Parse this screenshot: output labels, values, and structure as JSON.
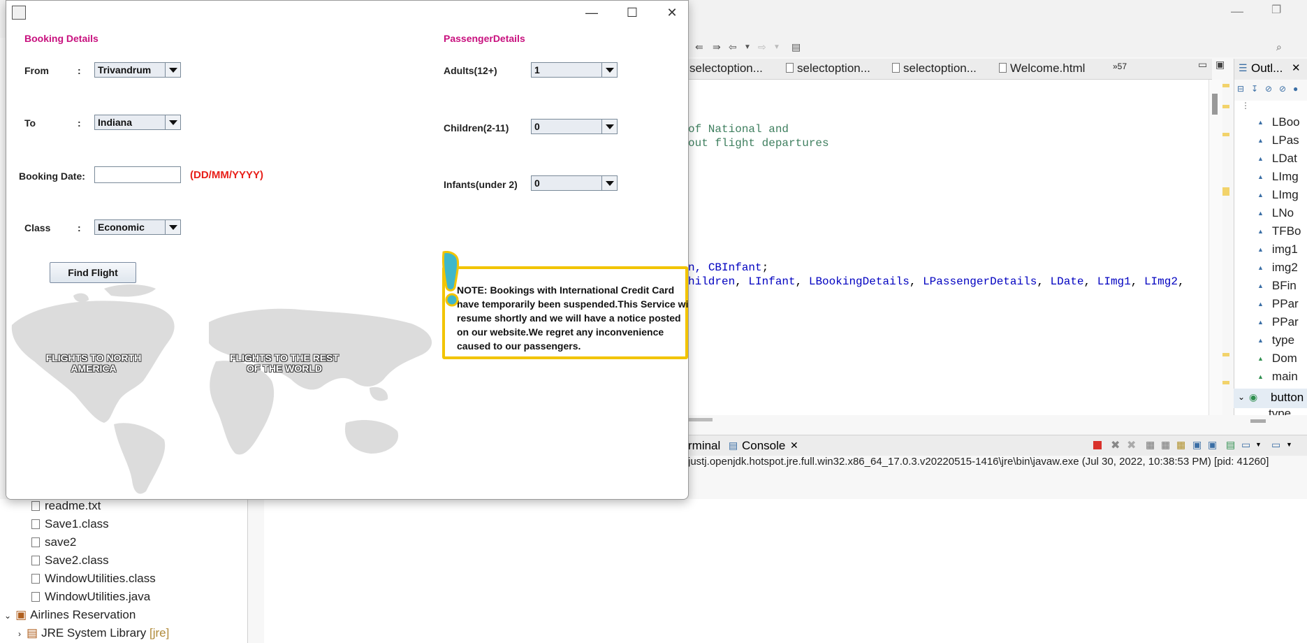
{
  "app": {
    "title": "",
    "window_controls": {
      "minimize": "—",
      "maximize": "☐",
      "close": "✕"
    },
    "booking_details_title": "Booking Details",
    "passenger_details_title": "PassengerDetails",
    "from": {
      "label": "From",
      "colon": ":",
      "value": "Trivandrum"
    },
    "to": {
      "label": "To",
      "colon": ":",
      "value": "Indiana"
    },
    "booking_date": {
      "label": "Booking Date:",
      "value": "",
      "format_hint": "(DD/MM/YYYY)"
    },
    "class": {
      "label": "Class",
      "colon": ":",
      "value": "Economic"
    },
    "find_flight_button": "Find Flight",
    "adults": {
      "label": "Adults(12+)",
      "value": "1"
    },
    "children": {
      "label": "Children(2-11)",
      "value": "0"
    },
    "infants": {
      "label": "Infants(under 2)",
      "value": "0"
    },
    "note": "NOTE: Bookings with International Credit Card have temporarily been suspended.This Service will resume shortly and we will have a notice posted on our website.We regret any inconvenience caused to our passengers.",
    "map_labels": {
      "north_america": "FLIGHTS TO NORTH AMERICA",
      "rest_of_world": "FLIGHTS TO THE REST OF THE WORLD"
    }
  },
  "ide": {
    "tabs": [
      "selectoption...",
      "selectoption...",
      "selectoption...",
      "Welcome.html",
      "»57"
    ],
    "code": {
      "line1": "of National and",
      "line2": "out flight departures",
      "line3_a": "n, ",
      "line3_b": "CBInfant",
      "line3_c": ";",
      "line4_a": "hildren",
      "line4_sep1": ", ",
      "line4_b": "LInfant",
      "line4_sep2": ", ",
      "line4_c": "LBookingDetails",
      "line4_sep3": ", ",
      "line4_d": "LPassengerDetails",
      "line4_sep4": ", ",
      "line4_e": "LDate",
      "line4_sep5": ", ",
      "line4_f": "LImg1",
      "line4_sep6": ", ",
      "line4_g": "LImg2",
      "line4_sep7": ","
    },
    "outline_title": "Outl...",
    "outline_items": [
      "LBoo",
      "LPas",
      "LDat",
      "LImg",
      "LImg",
      "LNo",
      "TFBo",
      "img1",
      "img2",
      "BFin",
      "PPar",
      "PPar",
      "type",
      "Dom",
      "main"
    ],
    "outline_node": "button",
    "outline_last": "type",
    "console_tabs": {
      "terminal": "rminal",
      "console": "Console"
    },
    "console_line": "justj.openjdk.hotspot.jre.full.win32.x86_64_17.0.3.v20220515-1416\\jre\\bin\\javaw.exe  (Jul 30, 2022, 10:38:53 PM) [pid: 41260]",
    "package_items": [
      "readme.txt",
      "Save1.class",
      "save2",
      "Save2.class",
      "WindowUtilities.class",
      "WindowUtilities.java"
    ],
    "project": "Airlines Reservation",
    "jre_library": "JRE System Library",
    "jre_tag": "[jre]"
  },
  "colors": {
    "section_title": "#c8107e",
    "date_hint": "#e8201a",
    "note_border": "#f2c400",
    "exclamation": "#3fb7c9",
    "code_comment": "#3f7f5f",
    "code_field": "#0000c0"
  }
}
